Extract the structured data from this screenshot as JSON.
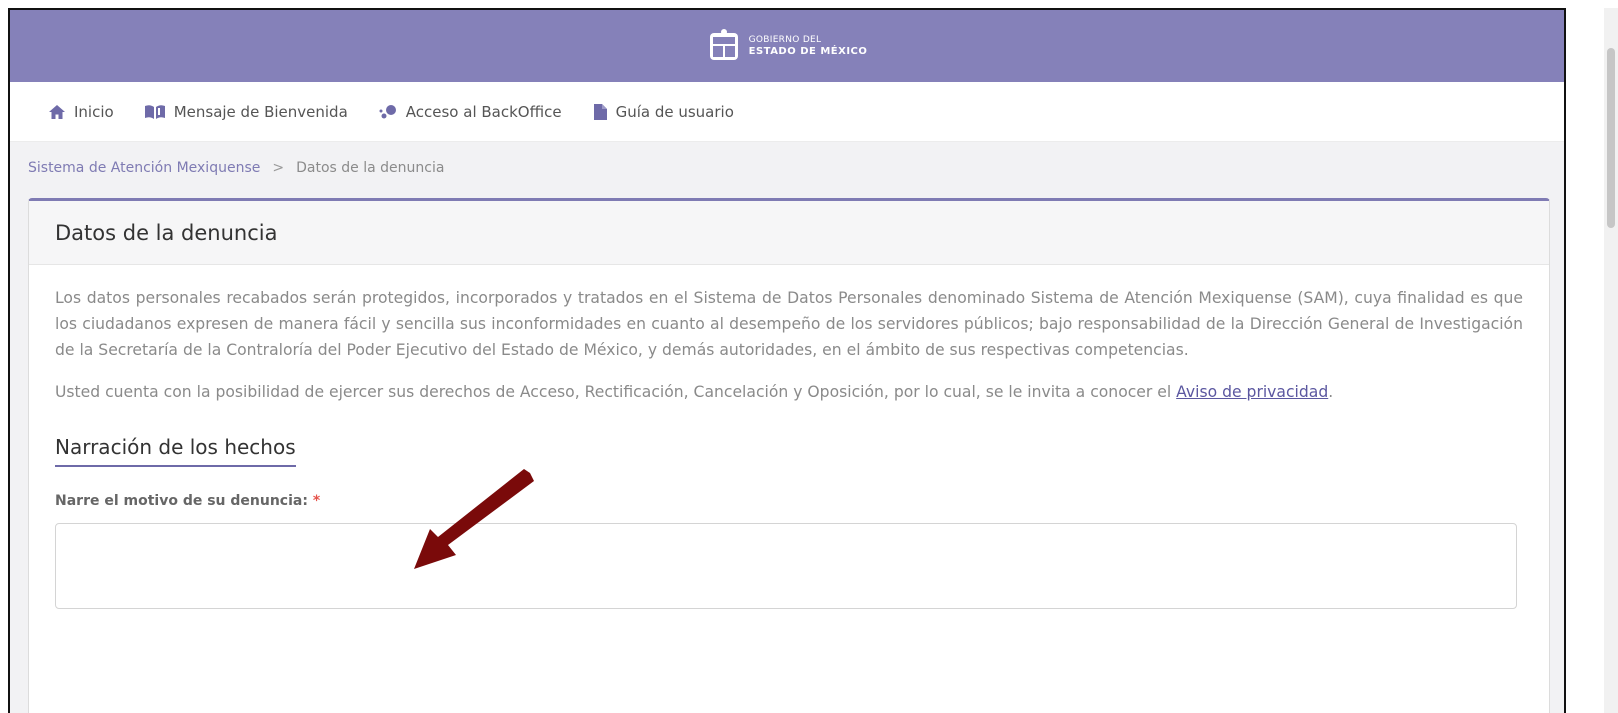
{
  "header": {
    "logo_line1": "GOBIERNO DEL",
    "logo_line2": "ESTADO DE MÉXICO",
    "color": "#8581b9"
  },
  "nav": {
    "items": [
      {
        "label": "Inicio",
        "icon": "home-icon"
      },
      {
        "label": "Mensaje de Bienvenida",
        "icon": "book-icon"
      },
      {
        "label": "Acceso al BackOffice",
        "icon": "molecule-icon"
      },
      {
        "label": "Guía de usuario",
        "icon": "document-icon"
      }
    ]
  },
  "breadcrumb": {
    "parent": "Sistema de Atención Mexiquense",
    "separator": ">",
    "current": "Datos de la denuncia"
  },
  "card": {
    "title": "Datos de la denuncia",
    "paragraph1": "Los datos personales recabados serán protegidos, incorporados y tratados en el Sistema de Datos Personales denominado Sistema de Atención Mexiquense (SAM), cuya finalidad es que los ciudadanos expresen de manera fácil y sencilla sus inconformidades en cuanto al desempeño de los servidores públicos; bajo responsabilidad de la Dirección General de Investigación de la Secretaría de la Contraloría del Poder Ejecutivo del Estado de México, y demás autoridades, en el ámbito de sus respectivas competencias.",
    "paragraph2_text": "Usted cuenta con la posibilidad de ejercer sus derechos de Acceso, Rectificación, Cancelación y Oposición, por lo cual, se le invita a conocer el ",
    "privacy_link": "Aviso de privacidad",
    "paragraph2_end": ".",
    "section_title": "Narración de los hechos",
    "field_label": "Narre el motivo de su denuncia:",
    "required_mark": "*",
    "field_value": ""
  },
  "colors": {
    "accent": "#7f7bb3",
    "arrow": "#7a0a0a"
  }
}
